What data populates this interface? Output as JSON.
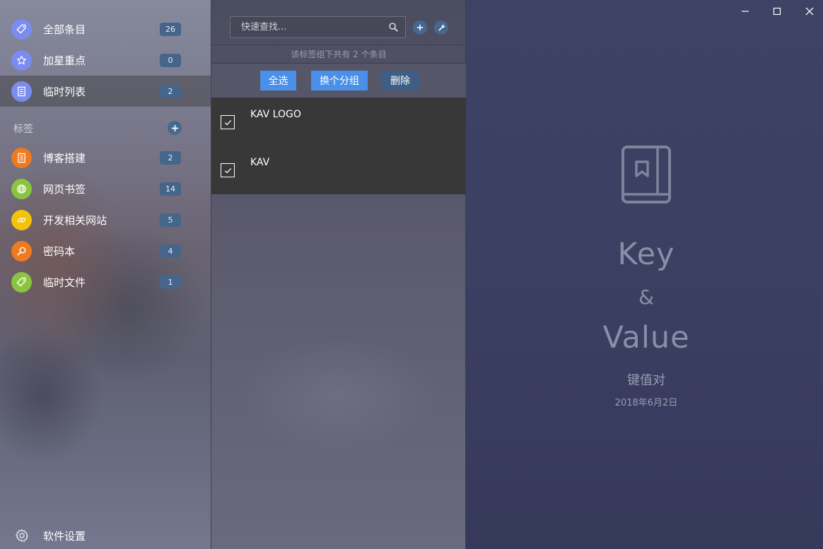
{
  "sidebar": {
    "items": [
      {
        "label": "全部条目",
        "count": "26",
        "icon": "tag-icon",
        "color": "#7b8cf0"
      },
      {
        "label": "加星重点",
        "count": "0",
        "icon": "star-icon",
        "color": "#7b8cf0"
      },
      {
        "label": "临时列表",
        "count": "2",
        "icon": "list-icon",
        "color": "#7b8cf0"
      }
    ],
    "tags_label": "标签",
    "tags": [
      {
        "label": "博客搭建",
        "count": "2",
        "icon": "document-icon",
        "color": "#ef7a1f"
      },
      {
        "label": "网页书签",
        "count": "14",
        "icon": "globe-icon",
        "color": "#8bc53f"
      },
      {
        "label": "开发相关网站",
        "count": "5",
        "icon": "link-icon",
        "color": "#f2c20c"
      },
      {
        "label": "密码本",
        "count": "4",
        "icon": "search-key-icon",
        "color": "#ef7a1f"
      },
      {
        "label": "临时文件",
        "count": "1",
        "icon": "tag-icon",
        "color": "#8bc53f"
      }
    ],
    "settings_label": "软件设置"
  },
  "middle": {
    "search_placeholder": "快速查找...",
    "info": "该标签组下共有 2 个条目",
    "actions": {
      "select_all": "全选",
      "change_group": "换个分组",
      "delete": "删除"
    },
    "items": [
      {
        "title": "KAV LOGO",
        "checked": true
      },
      {
        "title": "KAV",
        "checked": true
      }
    ]
  },
  "right": {
    "brand_key": "Key",
    "brand_amp": "&",
    "brand_value": "Value",
    "subtitle": "键值对",
    "date": "2018年6月2日"
  },
  "colors": {
    "accent_blue": "#46678f",
    "button_blue": "#4a90e8",
    "button_dark": "#3f5e86"
  }
}
